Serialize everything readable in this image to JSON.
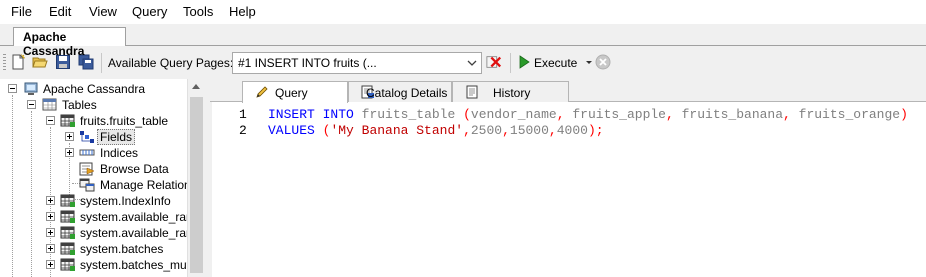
{
  "menu": {
    "items": [
      "File",
      "Edit",
      "View",
      "Query",
      "Tools",
      "Help"
    ]
  },
  "document_tab": {
    "label": "Apache Cassandra"
  },
  "toolbar": {
    "query_pages_label": "Available Query Pages:",
    "query_pages_selected": "#1 INSERT INTO fruits (...",
    "execute_label": "Execute"
  },
  "tree": {
    "root": "Apache Cassandra",
    "tables": "Tables",
    "fruits_table": "fruits.fruits_table",
    "fields": "Fields",
    "indices": "Indices",
    "browse_data": "Browse Data",
    "manage_relations": "Manage Relationsl",
    "system_items": [
      "system.IndexInfo",
      "system.available_range",
      "system.available_range",
      "system.batches",
      "system.batches_mutati"
    ]
  },
  "query_tabs": {
    "query": "Query",
    "catalog": "Catalog Details",
    "history": "History"
  },
  "editor": {
    "line_numbers": [
      "1",
      "2"
    ],
    "line1": {
      "kw1": "INSERT",
      "kw2": "INTO",
      "table": "fruits_table",
      "lparen": "(",
      "col1": "vendor_name",
      "col2": "fruits_apple",
      "col3": "fruits_banana",
      "col4": "fruits_orange",
      "rparen": ")",
      "comma": ","
    },
    "line2": {
      "kw": "VALUES",
      "lparen": "(",
      "string": "'My Banana Stand'",
      "v1": "2500",
      "v2": "15000",
      "v3": "4000",
      "rparen": ")",
      "semi": ";",
      "comma": ","
    }
  },
  "colors": {
    "keyword": "#0000ff",
    "punctuation": "#ff0000",
    "identifier": "#808080",
    "string": "#c00000"
  }
}
